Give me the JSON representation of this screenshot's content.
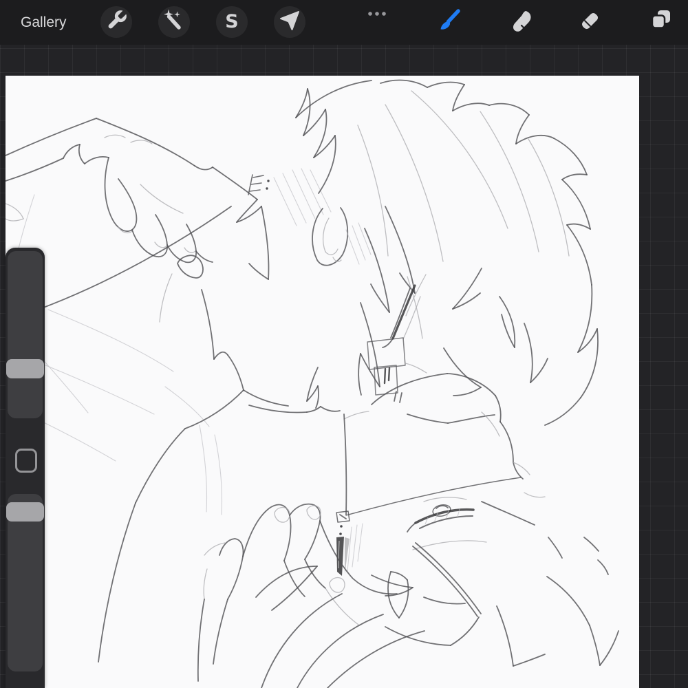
{
  "toolbar": {
    "gallery_label": "Gallery",
    "left_tools": [
      {
        "id": "actions",
        "icon": "wrench-icon"
      },
      {
        "id": "adjustments",
        "icon": "magic-wand-icon"
      },
      {
        "id": "selection",
        "icon": "selection-s-icon",
        "glyph": "S"
      },
      {
        "id": "transform",
        "icon": "transform-arrow-icon"
      }
    ],
    "more_options_icon": "ellipsis-icon",
    "right_tools": [
      {
        "id": "paint",
        "icon": "paintbrush-icon",
        "active": true
      },
      {
        "id": "smudge",
        "icon": "smudge-icon",
        "active": false
      },
      {
        "id": "erase",
        "icon": "eraser-icon",
        "active": false
      },
      {
        "id": "layers",
        "icon": "layers-icon",
        "active": false
      }
    ],
    "accent_color": "#1f7cf4",
    "bar_color": "#1c1c1e",
    "icon_color": "#d4d4d6"
  },
  "sidebar": {
    "brush_size_percent": 73,
    "opacity_percent": 5
  },
  "canvas": {
    "background_color": "#fafafb",
    "description": "Pencil sketch: two characters close together, one leaning down with spiky hair and closed eyes, hand resting on their shoulder; the other lying beneath with an upside-down face, dangling earring, and a hand touching their cheek, wavy hair spreading below. Small E: mark near the collar."
  },
  "workspace": {
    "background_color": "#232326",
    "grid_visible": true
  }
}
